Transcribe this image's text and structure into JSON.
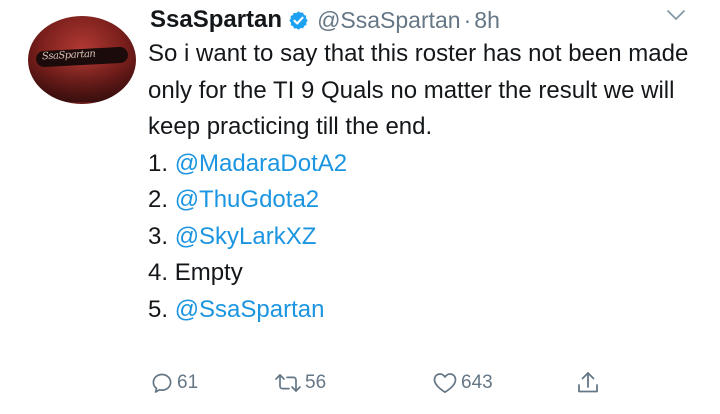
{
  "tweet": {
    "display_name": "SsaSpartan",
    "handle": "@SsaSpartan",
    "separator": "·",
    "time": "8h",
    "avatar_lettering": "SsaSpartan",
    "text": "So i want to say that this roster has not been made only for the TI 9 Quals no matter the result we will keep practicing till the end.",
    "roster": [
      {
        "number": "1.",
        "name": "@MadaraDotA2",
        "is_mention": true
      },
      {
        "number": "2.",
        "name": "@ThuGdota2",
        "is_mention": true
      },
      {
        "number": "3.",
        "name": "@SkyLarkXZ",
        "is_mention": true
      },
      {
        "number": "4.",
        "name": "Empty",
        "is_mention": false
      },
      {
        "number": "5.",
        "name": "@SsaSpartan",
        "is_mention": true
      }
    ],
    "actions": {
      "reply_count": "61",
      "retweet_count": "56",
      "like_count": "643"
    }
  },
  "icons": {
    "verified": "verified-badge-icon",
    "more": "chevron-down-icon",
    "reply": "reply-bubble-icon",
    "retweet": "retweet-arrows-icon",
    "like": "heart-icon",
    "share": "share-upload-icon"
  },
  "colors": {
    "text": "#14171a",
    "secondary": "#657786",
    "mention": "#1b95e0",
    "verified": "#1da1f2"
  }
}
